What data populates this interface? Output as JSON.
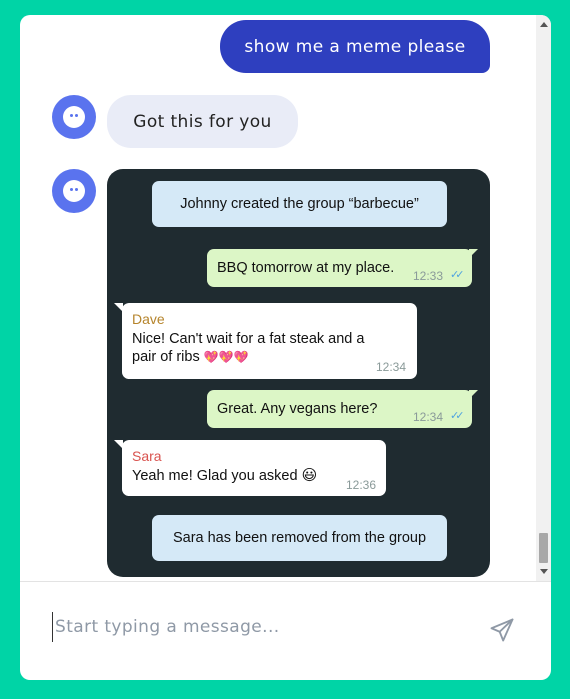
{
  "conversation": {
    "user_message": "show me a meme please",
    "bot_message": "Got this for you"
  },
  "meme": {
    "system_created": "Johnny created the group “barbecue”",
    "msg1_text": "BBQ tomorrow at my place.",
    "msg1_time": "12:33",
    "msg2_name": "Dave",
    "msg2_line1": "Nice! Can't wait for a fat steak and a",
    "msg2_line2": "pair of ribs",
    "msg2_emoji": "💖💖💖",
    "msg2_time": "12:34",
    "msg3_text": "Great. Any vegans here?",
    "msg3_time": "12:34",
    "msg4_name": "Sara",
    "msg4_text": "Yeah me! Glad you asked",
    "msg4_emoji": "😃",
    "msg4_time": "12:36",
    "system_removed": "Sara has been removed from the group"
  },
  "composer": {
    "placeholder": "Start typing a message..."
  },
  "icons": {
    "avatar": "bot-face-icon",
    "send": "paper-plane-icon",
    "read_receipt": "double-check-icon"
  },
  "colors": {
    "background": "#00d4a6",
    "user_bubble": "#2e3fbf",
    "bot_bubble": "#e9ecf7",
    "avatar": "#5a73ee"
  }
}
